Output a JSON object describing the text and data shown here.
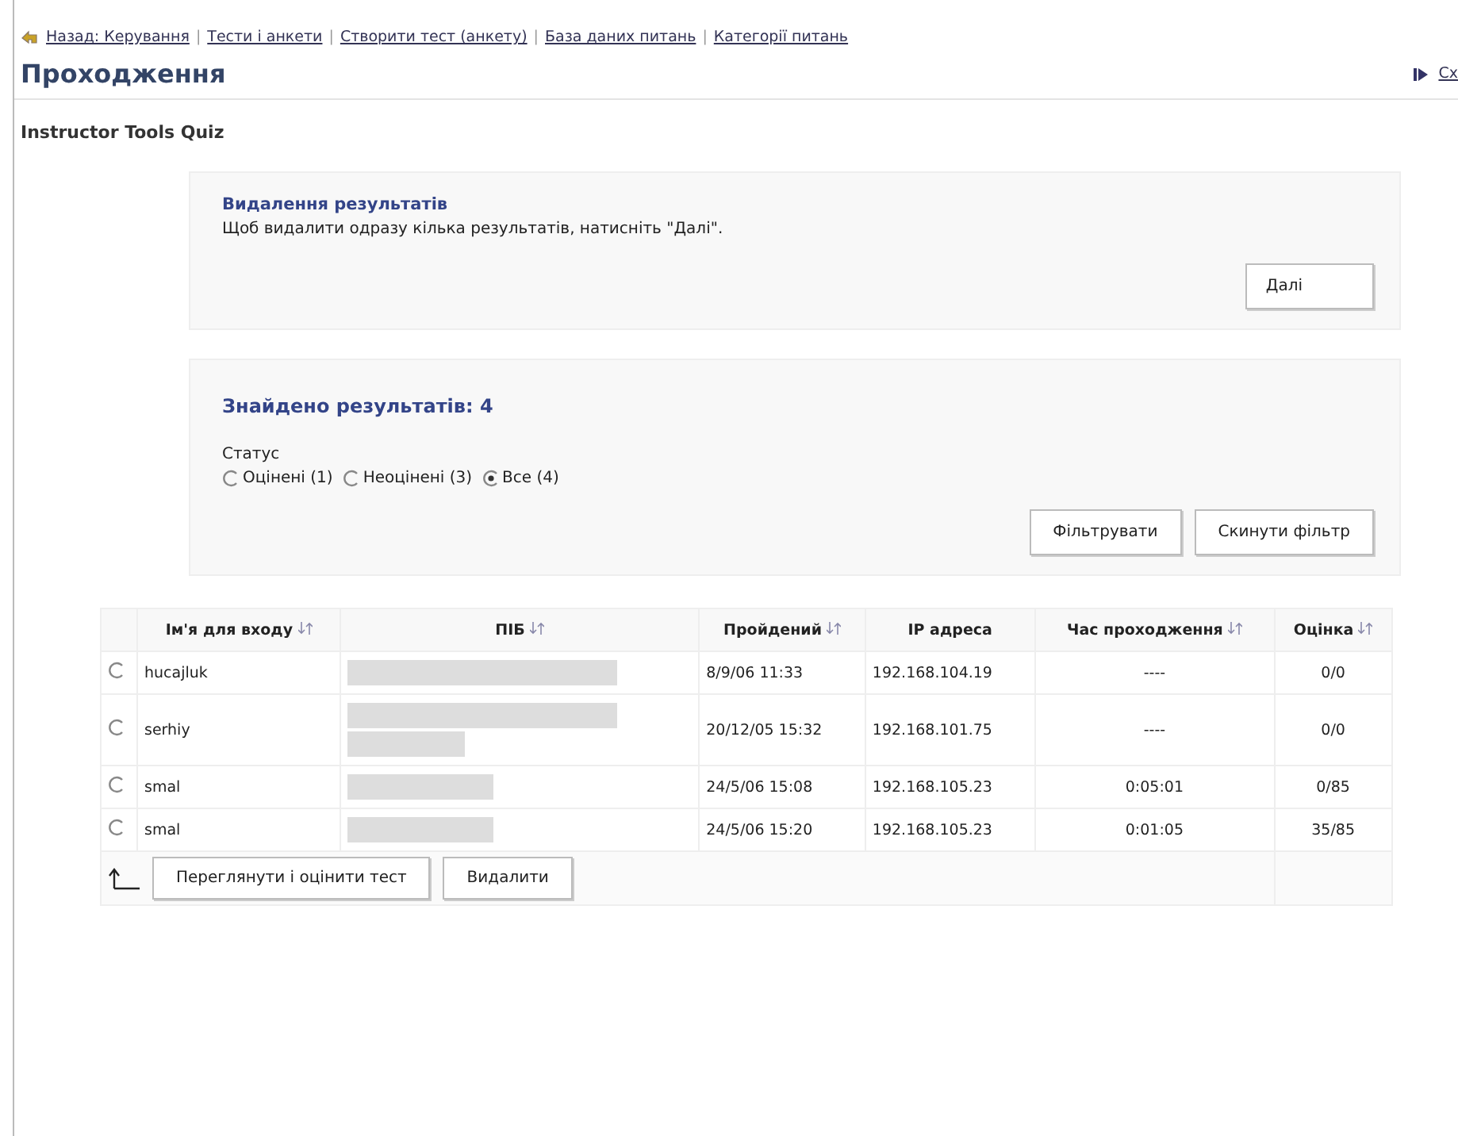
{
  "separator": "|",
  "breadcrumbs": [
    "Назад: Керування",
    "Тести і анкети",
    "Створити тест (анкету)",
    "База даних питань",
    "Категорії питань"
  ],
  "title": "Проходження",
  "side_link": "Сх",
  "quiz_title": "Instructor Tools Quiz",
  "delete_panel": {
    "heading": "Видалення результатів",
    "text": "Щоб видалити одразу кілька результатів, натисніть \"Далі\".",
    "button": "Далі"
  },
  "filter_panel": {
    "heading": "Знайдено результатів: 4",
    "status_label": "Статус",
    "options": [
      {
        "label": "Оцінені (1)",
        "selected": false
      },
      {
        "label": "Неоцінені (3)",
        "selected": false
      },
      {
        "label": "Все (4)",
        "selected": true
      }
    ],
    "buttons": [
      "Фільтрувати",
      "Скинути фільтр"
    ]
  },
  "table": {
    "columns": [
      {
        "label": "Ім'я для входу",
        "sortable": true
      },
      {
        "label": "ПІБ",
        "sortable": true
      },
      {
        "label": "Пройдений",
        "sortable": true
      },
      {
        "label": "IP адреса",
        "sortable": false
      },
      {
        "label": "Час проходження",
        "sortable": true
      },
      {
        "label": "Оцінка",
        "sortable": true
      }
    ],
    "rows": [
      {
        "selected": false,
        "login": "hucajluk",
        "name_lines": [
          {
            "kind": "full"
          }
        ],
        "date": "8/9/06 11:33",
        "ip": "192.168.104.19",
        "time": "----",
        "grade": "0/0"
      },
      {
        "selected": false,
        "login": "serhiy",
        "name_lines": [
          {
            "kind": "full"
          },
          {
            "kind": "short"
          }
        ],
        "date": "20/12/05 15:32",
        "ip": "192.168.101.75",
        "time": "----",
        "grade": "0/0"
      },
      {
        "selected": false,
        "login": "smal",
        "name_lines": [
          {
            "kind": "medium"
          }
        ],
        "date": "24/5/06 15:08",
        "ip": "192.168.105.23",
        "time": "0:05:01",
        "grade": "0/85"
      },
      {
        "selected": false,
        "login": "smal",
        "name_lines": [
          {
            "kind": "medium"
          }
        ],
        "date": "24/5/06 15:20",
        "ip": "192.168.105.23",
        "time": "0:01:05",
        "grade": "35/85"
      }
    ],
    "actions": [
      "Переглянути і оцінити тест",
      "Видалити"
    ]
  }
}
